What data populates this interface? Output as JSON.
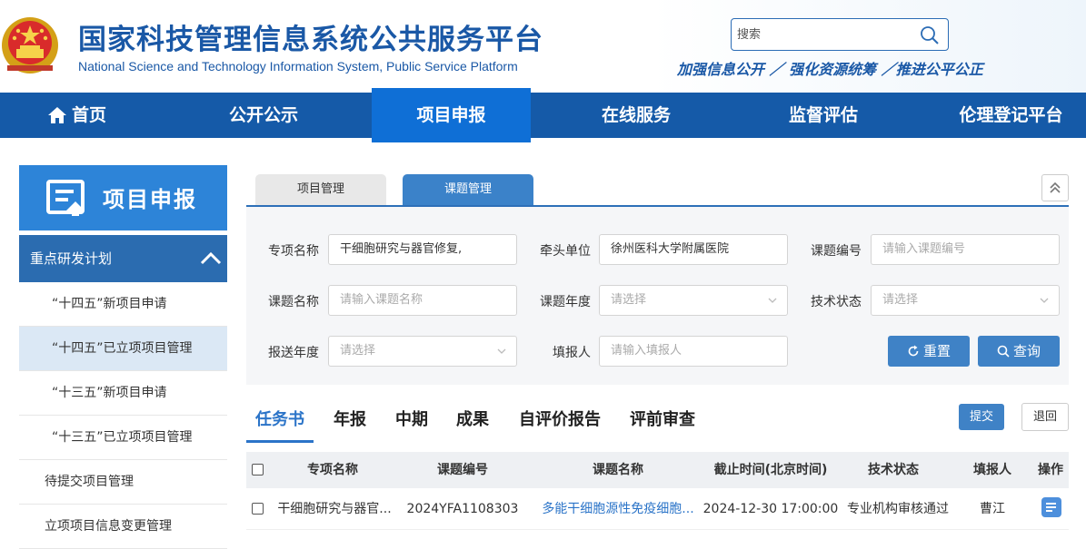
{
  "header": {
    "title": "国家科技管理信息系统公共服务平台",
    "subtitle": "National Science and Technology Information System, Public Service Platform",
    "search_placeholder": "搜索",
    "slogan": "加强信息公开 ／ 强化资源统筹 ／推进公平公正"
  },
  "nav": {
    "items": [
      {
        "label": "首页",
        "icon": "home-icon"
      },
      {
        "label": "公开公示"
      },
      {
        "label": "项目申报",
        "active": true
      },
      {
        "label": "在线服务"
      },
      {
        "label": "监督评估"
      },
      {
        "label": "伦理登记平台"
      }
    ]
  },
  "sidebar": {
    "banner_title": "项目申报",
    "plan_label": "重点研发计划",
    "items": [
      {
        "label": "“十四五”新项目申请"
      },
      {
        "label": "“十四五”已立项项目管理",
        "selected": true
      },
      {
        "label": "“十三五”新项目申请"
      },
      {
        "label": "“十三五”已立项项目管理"
      },
      {
        "label": "待提交项目管理"
      },
      {
        "label": "立项项目信息变更管理"
      }
    ]
  },
  "tabs": {
    "project_mgmt": "项目管理",
    "topic_mgmt": "课题管理"
  },
  "filters": {
    "special_name_label": "专项名称",
    "special_name_value": "干细胞研究与器官修复,",
    "lead_unit_label": "牵头单位",
    "lead_unit_value": "徐州医科大学附属医院",
    "topic_no_label": "课题编号",
    "topic_no_placeholder": "请输入课题编号",
    "topic_name_label": "课题名称",
    "topic_name_placeholder": "请输入课题名称",
    "topic_year_label": "课题年度",
    "topic_year_placeholder": "请选择",
    "tech_status_label": "技术状态",
    "tech_status_placeholder": "请选择",
    "submit_year_label": "报送年度",
    "submit_year_placeholder": "请选择",
    "filler_label": "填报人",
    "filler_placeholder": "请输入填报人",
    "reset_label": "重置",
    "query_label": "查询"
  },
  "subtabs": [
    "任务书",
    "年报",
    "中期",
    "成果",
    "自评价报告",
    "评前审查"
  ],
  "actions": {
    "submit": "提交",
    "back": "退回"
  },
  "table": {
    "headers": [
      "专项名称",
      "课题编号",
      "课题名称",
      "截止时间(北京时间)",
      "技术状态",
      "填报人",
      "操作"
    ],
    "rows": [
      {
        "special": "干细胞研究与器官...",
        "code": "2024YFA1108303",
        "name": "多能干细胞源性免疫细胞...",
        "deadline": "2024-12-30 17:00:00",
        "status": "专业机构审核通过",
        "filler": "曹江"
      }
    ]
  },
  "colors": {
    "brand": "#1a58a6",
    "nav": "#155aa8",
    "accent": "#3f82c6"
  }
}
